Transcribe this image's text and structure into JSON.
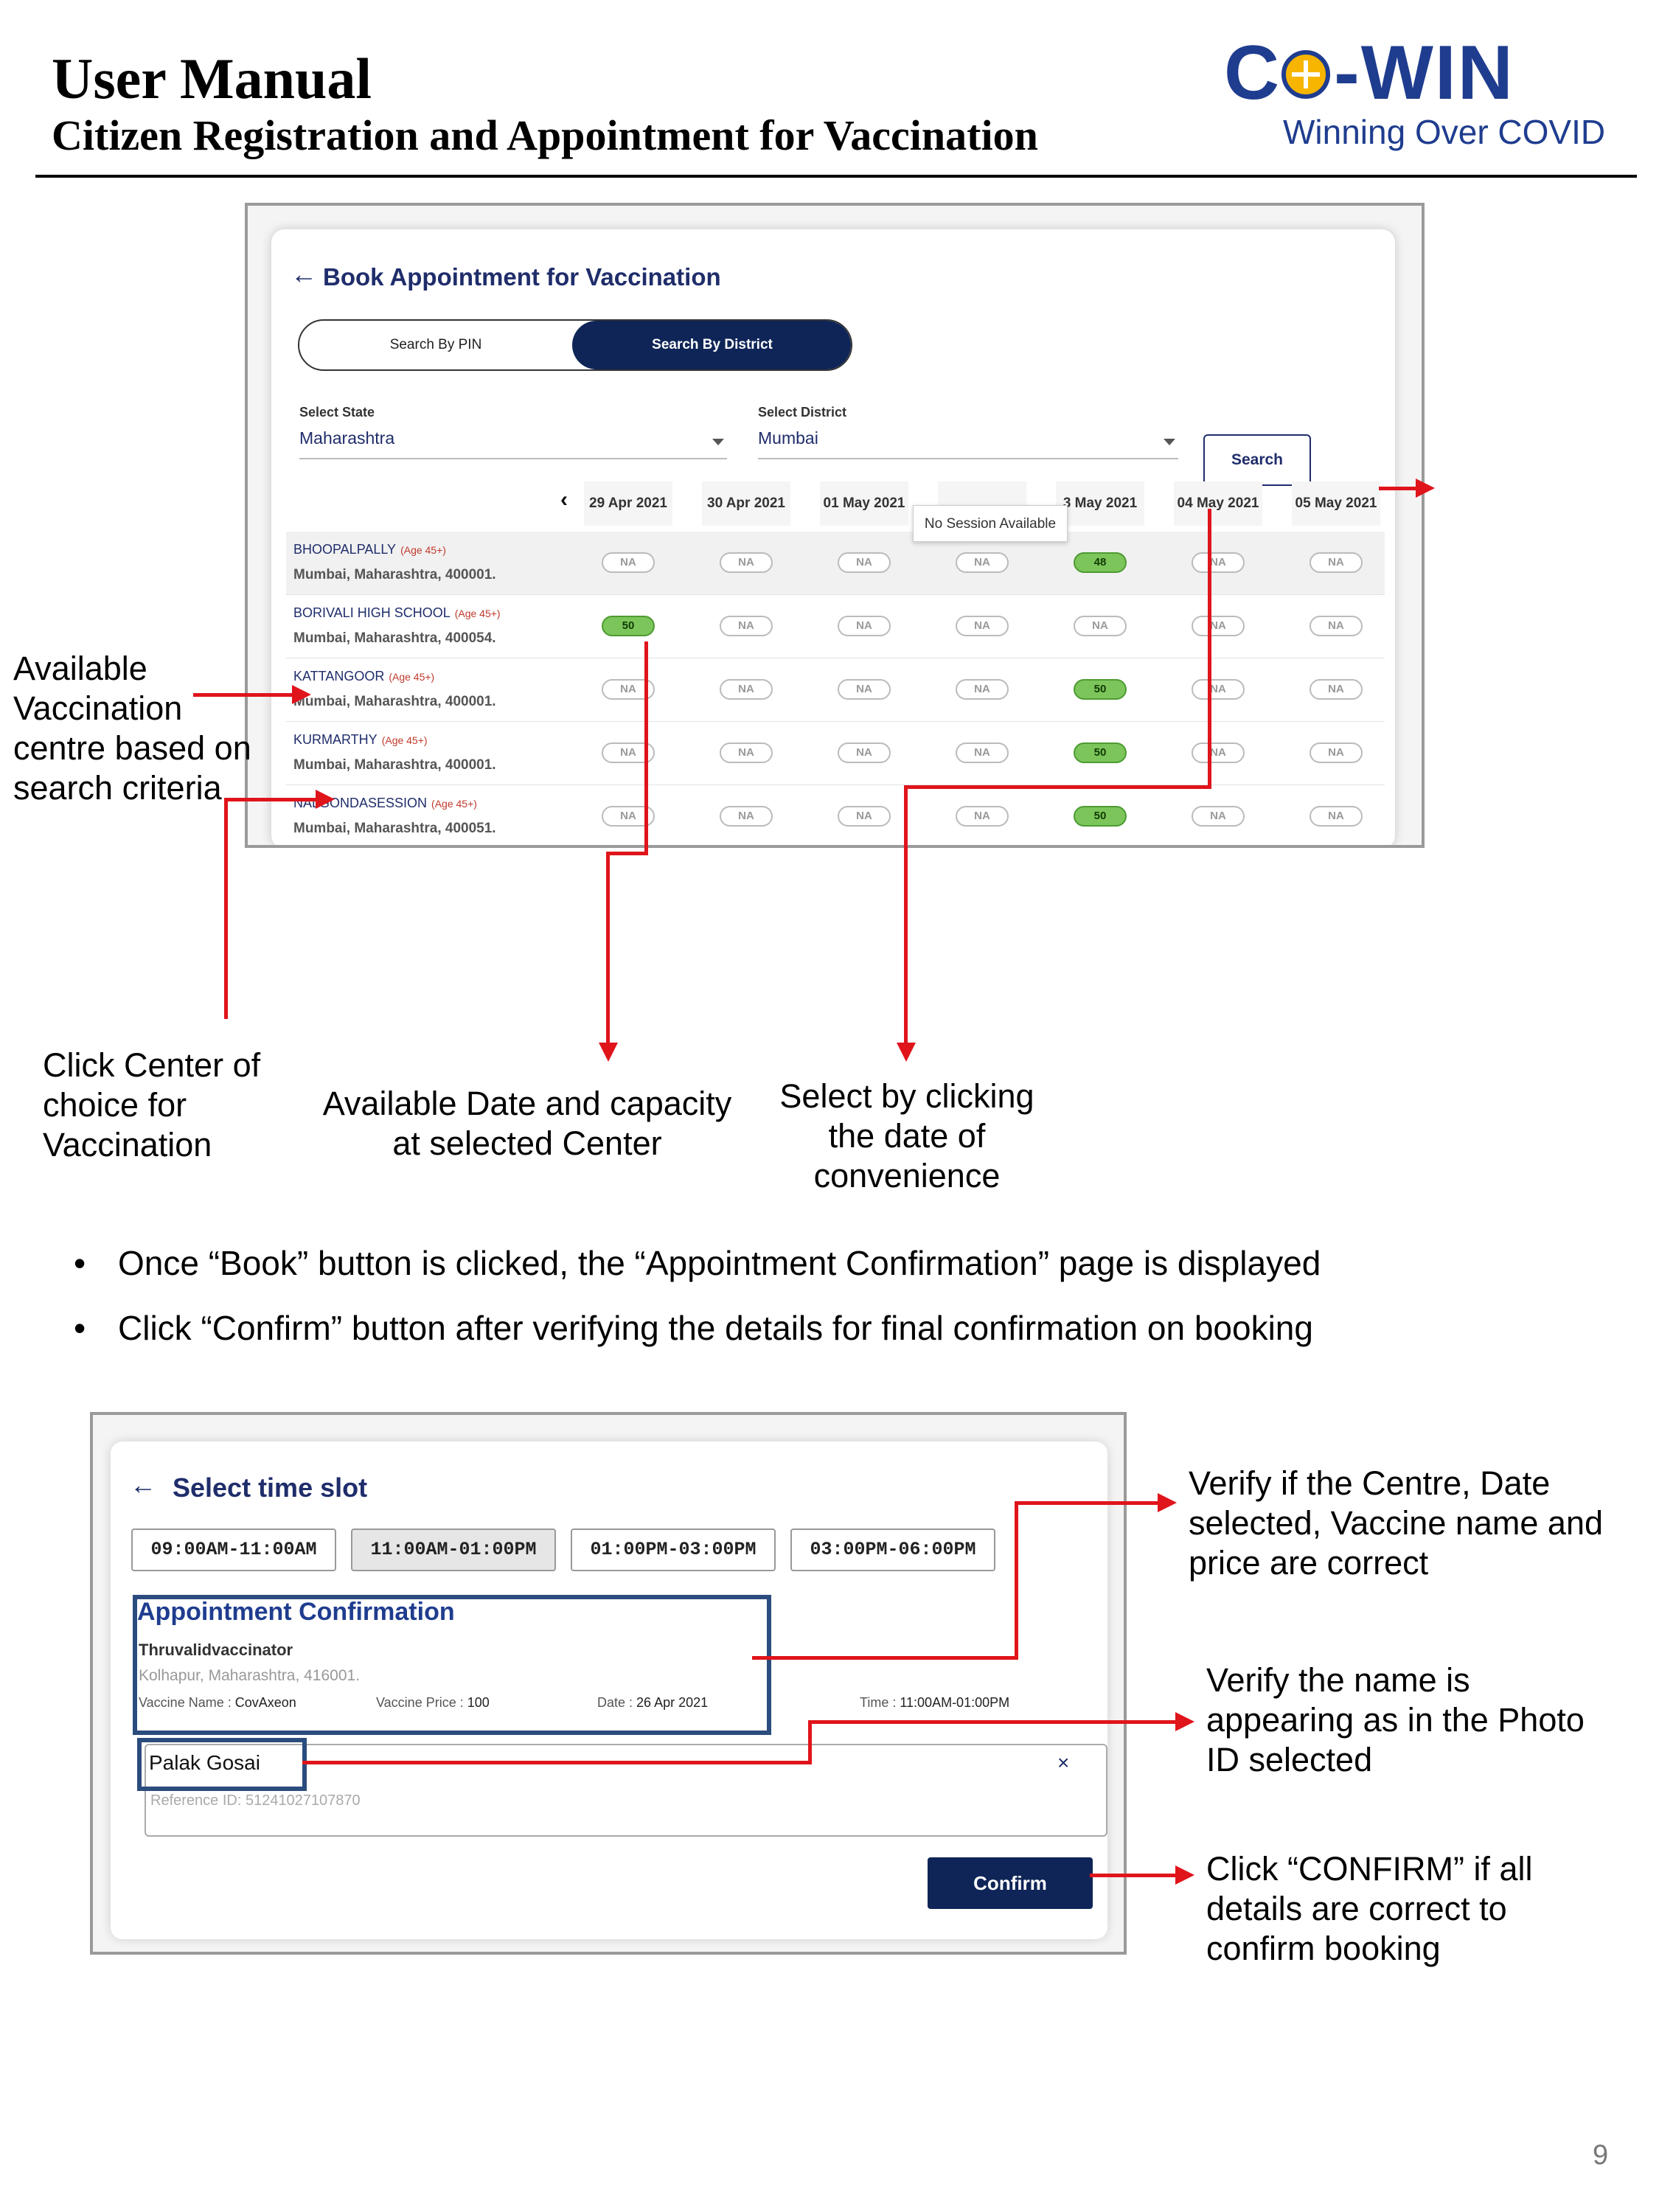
{
  "header": {
    "title": "User Manual",
    "subtitle": "Citizen Registration and Appointment for Vaccination",
    "logo_text": "C+-WIN",
    "logo_tagline": "Winning Over COVID"
  },
  "screen1": {
    "title": "Book Appointment for Vaccination",
    "toggle_pin": "Search By PIN",
    "toggle_district": "Search By District",
    "state_label": "Select State",
    "state_value": "Maharashtra",
    "district_label": "Select District",
    "district_value": "Mumbai",
    "search_label": "Search",
    "dates": [
      "29 Apr 2021",
      "30 Apr 2021",
      "01 May 2021",
      "",
      "3 May 2021",
      "04 May 2021",
      "05 May 2021"
    ],
    "tooltip": "No Session Available",
    "centres": [
      {
        "name": "BHOOPALPALLY",
        "age": "(Age 45+)",
        "address": "Mumbai, Maharashtra, 400001.",
        "slots": [
          "NA",
          "NA",
          "NA",
          "NA",
          "48",
          "NA",
          "NA"
        ]
      },
      {
        "name": "BORIVALI HIGH SCHOOL",
        "age": "(Age 45+)",
        "address": "Mumbai, Maharashtra, 400054.",
        "slots": [
          "50",
          "NA",
          "NA",
          "NA",
          "NA",
          "NA",
          "NA"
        ]
      },
      {
        "name": "KATTANGOOR",
        "age": "(Age 45+)",
        "address": "Mumbai, Maharashtra, 400001.",
        "slots": [
          "NA",
          "NA",
          "NA",
          "NA",
          "50",
          "NA",
          "NA"
        ]
      },
      {
        "name": "KURMARTHY",
        "age": "(Age 45+)",
        "address": "Mumbai, Maharashtra, 400001.",
        "slots": [
          "NA",
          "NA",
          "NA",
          "NA",
          "50",
          "NA",
          "NA"
        ]
      },
      {
        "name": "NALGONDASESSION",
        "age": "(Age 45+)",
        "address": "Mumbai, Maharashtra, 400051.",
        "slots": [
          "NA",
          "NA",
          "NA",
          "NA",
          "50",
          "NA",
          "NA"
        ]
      }
    ]
  },
  "annotations1": {
    "available_centre": "Available\nVaccination\ncentre based on\nsearch criteria",
    "click_centre": "Click Center of\nchoice for\nVaccination",
    "available_date": "Available Date and capacity\nat selected Center",
    "select_date": "Select by clicking\nthe date of\nconvenience"
  },
  "bullets": [
    "Once “Book” button is clicked, the “Appointment Confirmation” page is displayed",
    "Click “Confirm” button after verifying the details for final confirmation on booking"
  ],
  "screen2": {
    "title": "Select time slot",
    "slots": [
      "09:00AM-11:00AM",
      "11:00AM-01:00PM",
      "01:00PM-03:00PM",
      "03:00PM-06:00PM"
    ],
    "confirmation_title": "Appointment Confirmation",
    "centre_name": "Thruvalidvaccinator",
    "centre_address": "Kolhapur, Maharashtra, 416001.",
    "vaccine_name_label": "Vaccine Name :",
    "vaccine_name": "CovAxeon",
    "vaccine_price_label": "Vaccine Price :",
    "vaccine_price": "100",
    "date_label": "Date :",
    "date_value": "26 Apr 2021",
    "time_label": "Time :",
    "time_value": "11:00AM-01:00PM",
    "person_name": "Palak Gosai",
    "reference_id": "Reference ID: 51241027107870",
    "close_symbol": "×",
    "confirm_label": "Confirm"
  },
  "annotations2": {
    "verify_centre": "Verify if the Centre, Date\nselected, Vaccine name and\nprice are correct",
    "verify_name": "Verify the name is\nappearing as in the Photo\nID selected",
    "click_confirm": "Click “CONFIRM” if all\ndetails are correct to\nconfirm booking"
  },
  "page_number": "9",
  "colors": {
    "accent": "#e0141b",
    "brand": "#1f3d8f",
    "navy": "#0f2557",
    "available": "#7cc55a"
  }
}
